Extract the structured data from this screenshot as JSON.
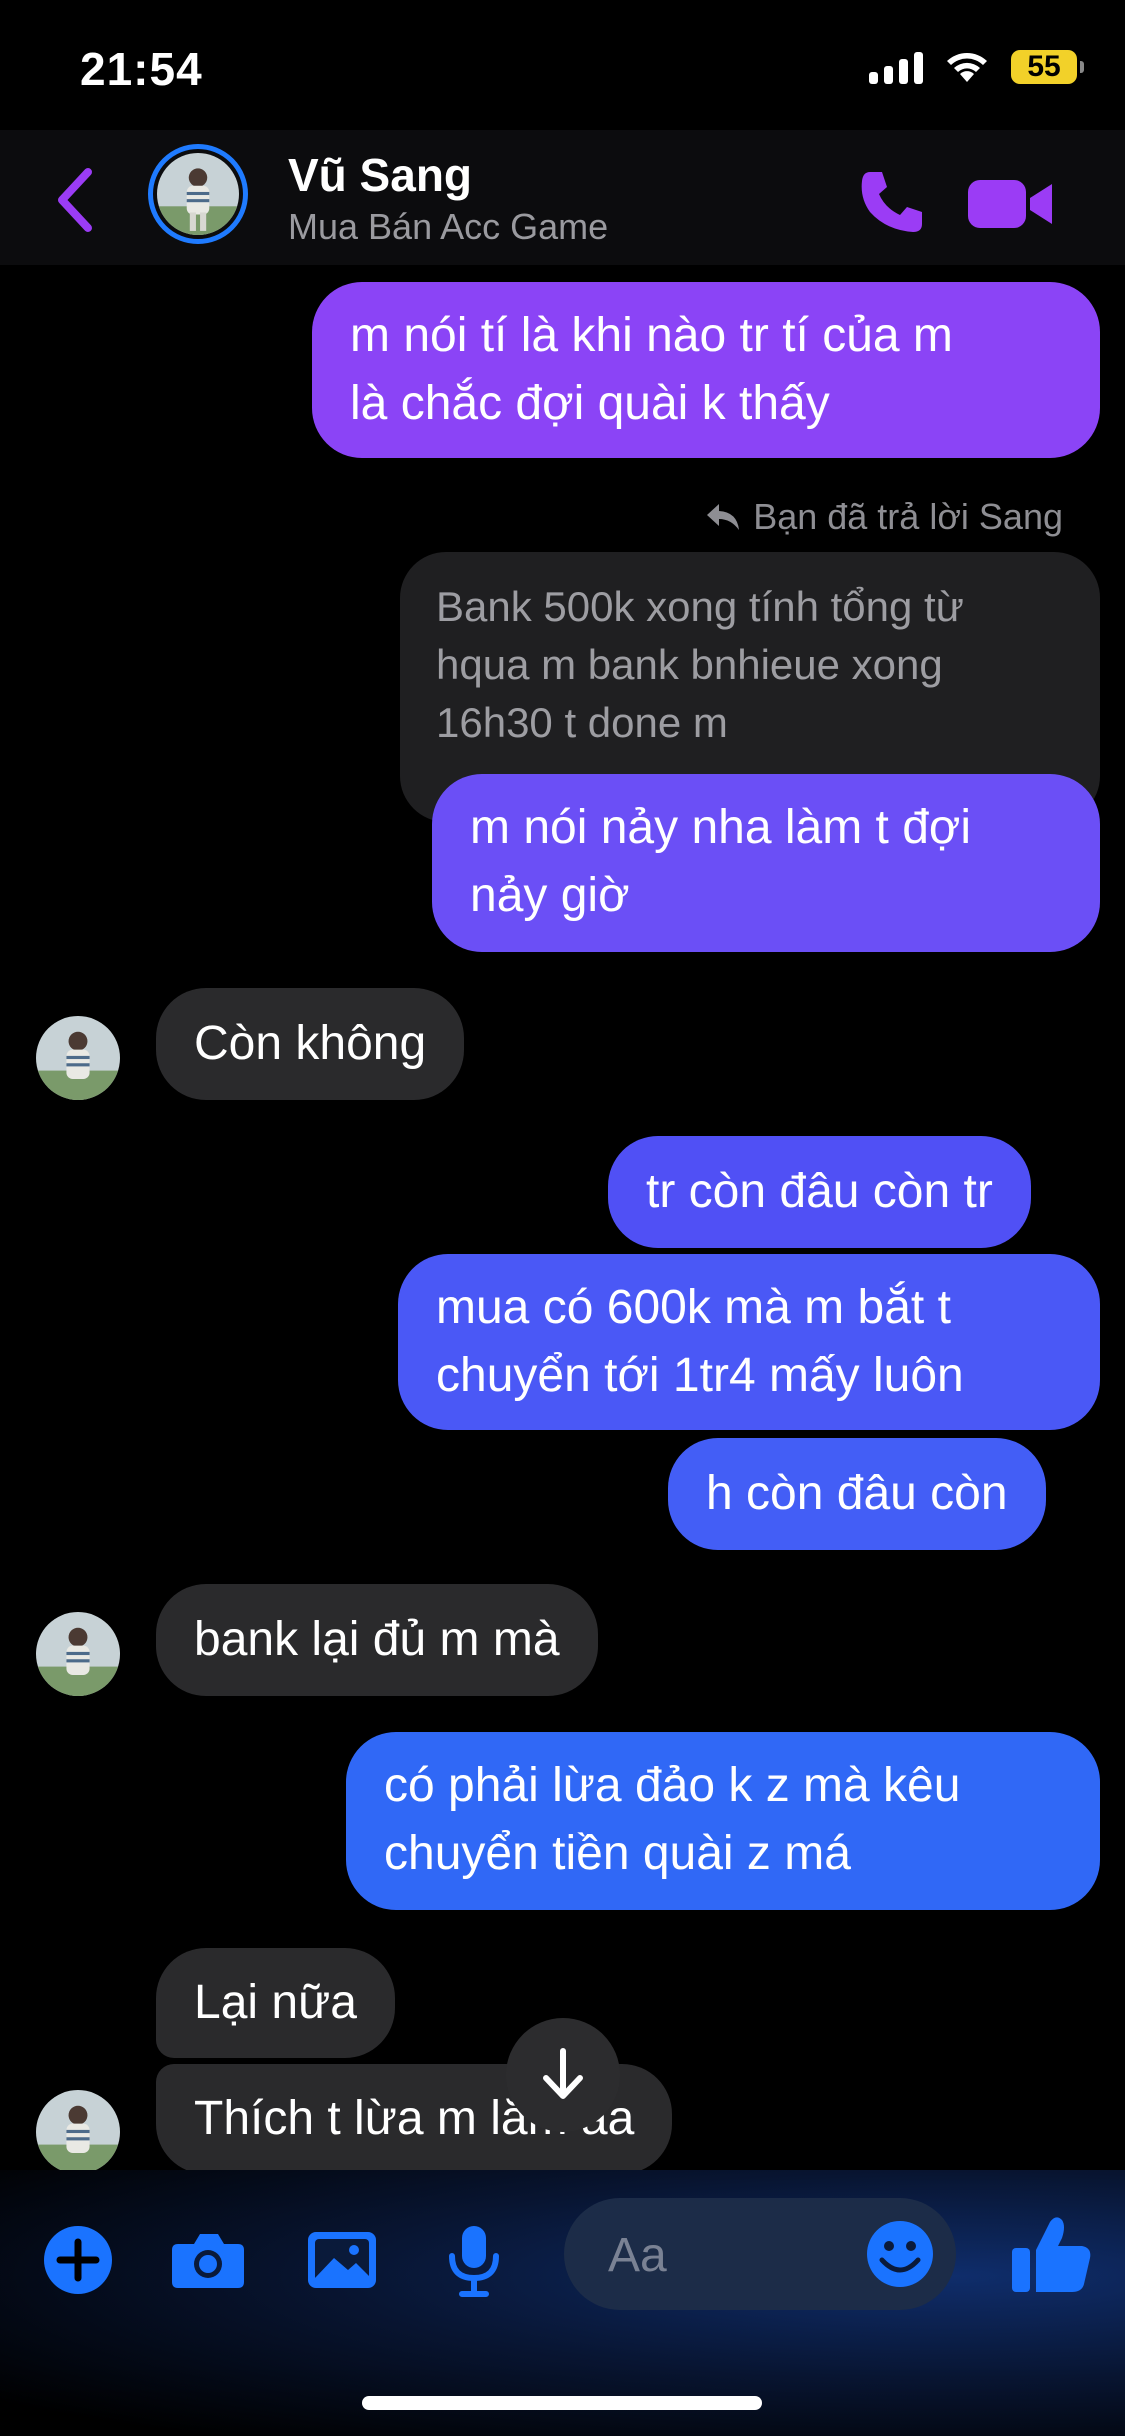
{
  "status_bar": {
    "time": "21:54",
    "battery": "55"
  },
  "header": {
    "contact_name": "Vũ Sang",
    "subtitle": "Mua Bán Acc Game"
  },
  "messages": {
    "m1": [
      "m nói tí là khi nào tr tí của m",
      "là chắc đợi quài k thấy"
    ],
    "reply_label": "Bạn đã trả lời Sang",
    "quoted": [
      "Bank 500k xong tính tổng từ",
      "hqua m bank bnhieue xong",
      "16h30 t done m"
    ],
    "m2": [
      "m nói nảy nha làm t đợi",
      "nảy giờ"
    ],
    "in1": "Còn không",
    "m3": "tr còn đâu còn tr",
    "m4": [
      "mua có 600k mà m bắt t",
      "chuyển tới 1tr4 mấy luôn"
    ],
    "m5": "h còn đâu còn",
    "in2": "bank lại đủ m mà",
    "m6": [
      "có phải lừa đảo k z mà kêu",
      "chuyển tiền quài z má"
    ],
    "in3": "Lại nữa",
    "in4": "Thích t lừa m lắm aa"
  },
  "composer": {
    "placeholder": "Aa"
  },
  "colors": {
    "accent": "#9b3cf5",
    "bubble_top": "#8b43f3",
    "bubble_bottom": "#2f6df6",
    "incoming": "#2a2a2c"
  }
}
